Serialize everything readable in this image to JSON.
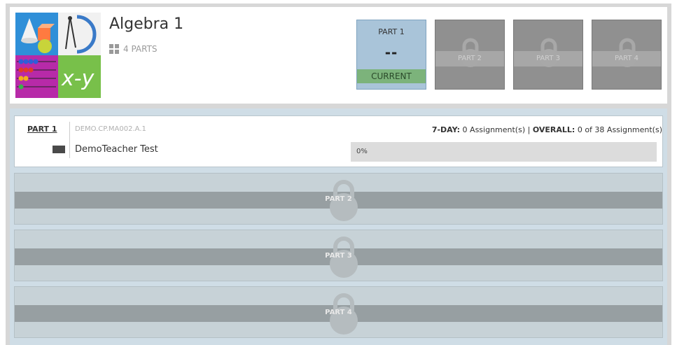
{
  "course": {
    "title": "Algebra 1",
    "parts_count": "4 PARTS",
    "image_text": "x-y"
  },
  "tiles": {
    "current": {
      "label": "PART 1",
      "value": "--",
      "status": "CURRENT"
    },
    "locked": [
      {
        "label": "PART 2"
      },
      {
        "label": "PART 3"
      },
      {
        "label": "PART 4"
      }
    ]
  },
  "parts": {
    "part1": {
      "name": "PART 1",
      "code": "DEMO.CP.MA002.A.1",
      "teacher": "DemoTeacher Test",
      "seven_day_label": "7-DAY:",
      "seven_day_value": "0 Assignment(s)",
      "separator": "|",
      "overall_label": "OVERALL:",
      "overall_value": "0 of 38 Assignment(s)",
      "progress_text": "0%",
      "progress_fraction": 0
    },
    "locked": [
      {
        "label": "PART 2"
      },
      {
        "label": "PART 3"
      },
      {
        "label": "PART 4"
      }
    ]
  },
  "colors": {
    "current_tile": "#a9c4d9",
    "current_status": "#7cb37b",
    "locked_tile": "#909090",
    "list_background": "#cfdde6"
  }
}
